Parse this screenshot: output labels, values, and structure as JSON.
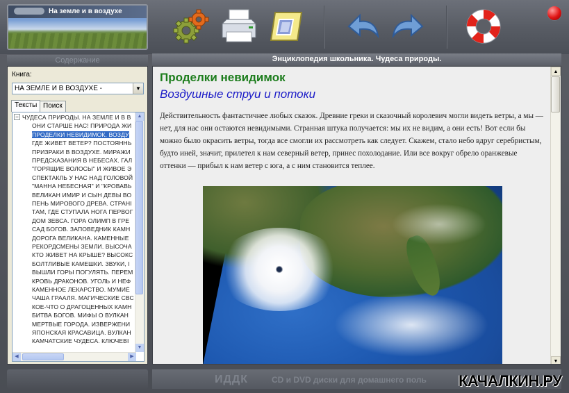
{
  "header": {
    "logo_title": "На земле и в воздухе",
    "toolbar": [
      "settings-icon",
      "print-icon",
      "bookmark-icon",
      "back-icon",
      "forward-icon",
      "help-icon"
    ]
  },
  "sidebar": {
    "section_title": "Содержание",
    "book_label": "Книга:",
    "book_selected": "НА ЗЕМЛЕ И В ВОЗДУХЕ -",
    "tabs": [
      "Тексты",
      "Поиск"
    ],
    "tree_items": [
      "ЧУДЕСА ПРИРОДЫ.  НА ЗЕМЛЕ И В В",
      "ОНИ СТАРШЕ НАС!  ПРИРОДА ЖИ",
      "ПРОДЕЛКИ НЕВИДИМОК. ВОЗДУ",
      "ГДЕ ЖИВЕТ ВЕТЕР?  ПОСТОЯННЬ",
      "ПРИЗРАКИ В ВОЗДУХЕ.  МИРАЖИ",
      "ПРЕДСКАЗАНИЯ В НЕБЕСАХ.  ГАЛ",
      "\"ГОРЯЩИЕ ВОЛОСЫ\" И ЖИВОЕ Э",
      "СПЕКТАКЛЬ У НАС НАД ГОЛОВОЙ",
      "\"МАННА НЕБЕСНАЯ\" И \"КРОВАВЬ",
      "ВЕЛИКАН ИМИР И СЫН ДЕВЫ ВО",
      "ПЕНЬ МИРОВОГО ДРЕВА.  СТРАНІ",
      "ТАМ, ГДЕ СТУПАЛА НОГА ПЕРВОГ",
      "ДОМ ЗЕВСА.  ГОРА ОЛИМП В ГРЕ",
      "САД БОГОВ.  ЗАПОВЕДНИК КАМН",
      "ДОРОГА ВЕЛИКАНА.  КАМЕННЫЕ",
      "РЕКОРДСМЕНЫ ЗЕМЛИ.  ВЫСОЧА",
      "КТО ЖИВЕТ НА КРЫШЕ?  ВЫСОКС",
      "БОЛТЛИВЫЕ КАМЕШКИ.  ЗВУКИ, І",
      "ВЫШЛИ ГОРЫ ПОГУЛЯТЬ.  ПЕРЕМ",
      "КРОВЬ ДРАКОНОВ.  УГОЛЬ И НЕФ",
      "КАМЕННОЕ ЛЕКАРСТВО.  МУМИЁ",
      "ЧАША ГРААЛЯ.  МАГИЧЕСКИЕ СВО",
      "КОЕ-ЧТО О ДРАГОЦЕННЫХ КАМН",
      "БИТВА БОГОВ.  МИФЫ О ВУЛКАН",
      "МЕРТВЫЕ ГОРОДА.  ИЗВЕРЖЕНИ",
      "ЯПОНСКАЯ КРАСАВИЦА.  ВУЛКАН",
      "КАМЧАТСКИЕ ЧУДЕСА.  КЛЮЧЕВІ"
    ],
    "selected_index": 2
  },
  "main": {
    "window_title": "Энциклопедия школьника. Чудеса природы.",
    "heading": "Проделки невидимок",
    "subheading": "Воздушные струи и потоки",
    "body": "Действительность фантастичнее любых сказок. Древние греки и сказочный королевич могли видеть ветры, а мы — нет, для нас они остаются невидимыми. Странная штука получается: мы их не видим, а они есть! Вот если бы можно было окрасить ветры, тогда все смогли их рассмотреть как следует. Скажем, стало небо вдруг серебристым, будто иней, значит, прилетел к нам северный ветер, принес похолодание. Или все вокруг обрело оранжевые оттенки — прибыл к нам ветер с юга, а с ним становится теплее."
  },
  "footer": {
    "brand": "ИДДК",
    "tagline": "CD и DVD диски для домашнего поль",
    "watermark": "КАЧАЛКИН.РУ"
  },
  "colors": {
    "heading": "#1d7d1d",
    "subheading": "#1c1cc8",
    "selection": "#316ac5",
    "close_button": "#e01414"
  }
}
